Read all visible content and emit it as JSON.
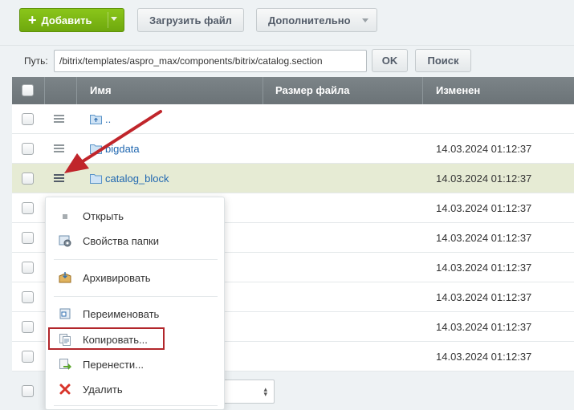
{
  "toolbar": {
    "add_label": "Добавить",
    "upload_label": "Загрузить файл",
    "more_label": "Дополнительно"
  },
  "path": {
    "label": "Путь:",
    "value": "/bitrix/templates/aspro_max/components/bitrix/catalog.section",
    "ok_label": "OK",
    "search_label": "Поиск"
  },
  "table": {
    "headers": {
      "name": "Имя",
      "size": "Размер файла",
      "modified": "Изменен"
    },
    "rows": [
      {
        "name": "..",
        "date": ""
      },
      {
        "name": "bigdata",
        "date": "14.03.2024 01:12:37"
      },
      {
        "name": "catalog_block",
        "date": "14.03.2024 01:12:37"
      },
      {
        "name": "",
        "date": "14.03.2024 01:12:37"
      },
      {
        "name": "",
        "date": "14.03.2024 01:12:37"
      },
      {
        "name": "",
        "date": "14.03.2024 01:12:37"
      },
      {
        "name": "",
        "date": "14.03.2024 01:12:37"
      },
      {
        "name": "",
        "date": "14.03.2024 01:12:37"
      },
      {
        "name": "",
        "date": "14.03.2024 01:12:37"
      }
    ]
  },
  "context_menu": {
    "items": [
      {
        "label": "Открыть",
        "icon": "bullet-icon"
      },
      {
        "label": "Свойства папки",
        "icon": "folder-properties-icon"
      },
      {
        "label": "Архивировать",
        "icon": "archive-box-icon"
      },
      {
        "label": "Переименовать",
        "icon": "rename-icon"
      },
      {
        "label": "Копировать...",
        "icon": "copy-icon"
      },
      {
        "label": "Перенести...",
        "icon": "move-icon"
      },
      {
        "label": "Удалить",
        "icon": "delete-x-icon"
      }
    ]
  },
  "colors": {
    "add_button": "#7cb716",
    "header_bg": "#737b7f",
    "selected_row": "#e6ebd4",
    "link": "#2067b0",
    "annotation_red": "#c0252b"
  }
}
